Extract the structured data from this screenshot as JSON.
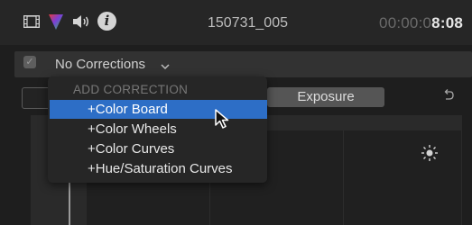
{
  "header": {
    "clip_name": "150731_005",
    "timecode_dim": "00:00:0",
    "timecode_bright": "8:08",
    "icons": [
      "film-icon",
      "color-icon",
      "audio-icon",
      "info-icon"
    ],
    "info_glyph": "i"
  },
  "corrections": {
    "checkbox_glyph": "✓",
    "label": "No Corrections",
    "chevron": "chevron-down-icon"
  },
  "tabs": {
    "active_label": "Exposure",
    "reset_icon": "reset-icon"
  },
  "menu": {
    "header": "ADD CORRECTION",
    "items": [
      {
        "label": "+Color Board",
        "selected": true
      },
      {
        "label": "+Color Wheels",
        "selected": false
      },
      {
        "label": "+Color Curves",
        "selected": false
      },
      {
        "label": "+Hue/Saturation Curves",
        "selected": false
      }
    ]
  },
  "colors": {
    "accent": "#2d6ec6",
    "background": "#1e1e1e",
    "panel": "#262626"
  }
}
